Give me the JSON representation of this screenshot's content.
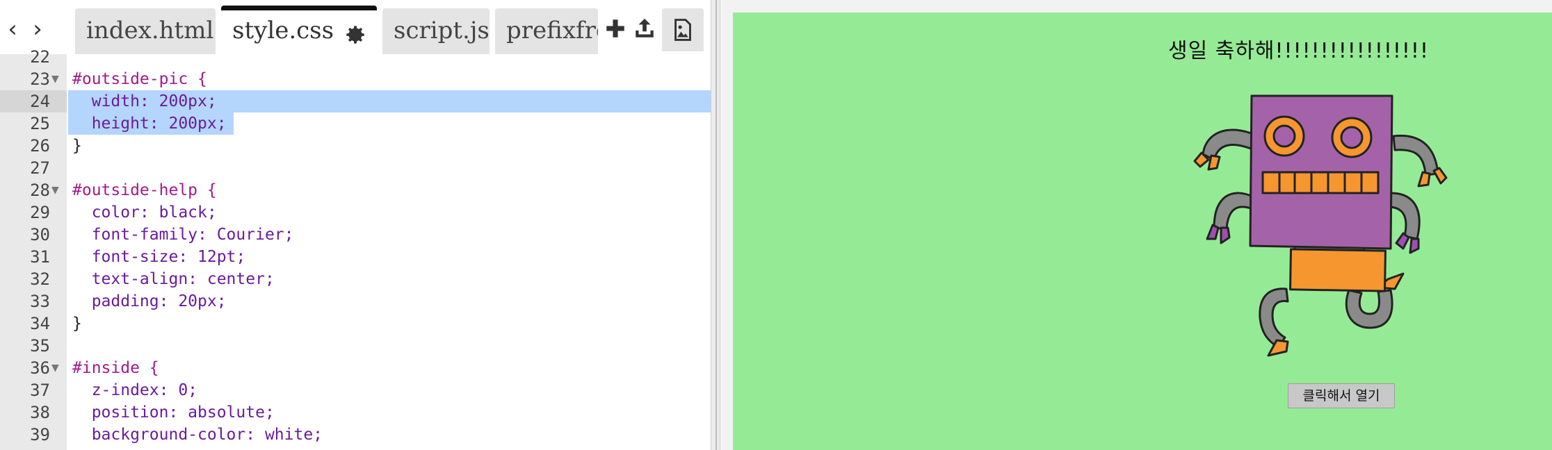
{
  "editor": {
    "nav": {
      "back_glyph": "‹",
      "forward_glyph": "›"
    },
    "tabs": [
      {
        "label": "index.html",
        "active": false
      },
      {
        "label": "style.css",
        "active": true
      },
      {
        "label": "script.js",
        "active": false
      },
      {
        "label": "prefixfree",
        "active": false
      }
    ],
    "toolbar": {
      "gear_icon": "gear-icon",
      "add_icon": "plus-icon",
      "upload_icon": "upload-icon",
      "image_icon": "image-icon"
    },
    "lines": [
      {
        "num": "22",
        "text": ""
      },
      {
        "num": "23",
        "text": "#outside-pic {"
      },
      {
        "num": "24",
        "text": "  width: 200px;"
      },
      {
        "num": "25",
        "text": "  height: 200px;"
      },
      {
        "num": "26",
        "text": "}"
      },
      {
        "num": "27",
        "text": ""
      },
      {
        "num": "28",
        "text": "#outside-help {"
      },
      {
        "num": "29",
        "text": "  color: black;"
      },
      {
        "num": "30",
        "text": "  font-family: Courier;"
      },
      {
        "num": "31",
        "text": "  font-size: 12pt;"
      },
      {
        "num": "32",
        "text": "  text-align: center;"
      },
      {
        "num": "33",
        "text": "  padding: 20px;"
      },
      {
        "num": "34",
        "text": "}"
      },
      {
        "num": "35",
        "text": ""
      },
      {
        "num": "36",
        "text": "#inside {"
      },
      {
        "num": "37",
        "text": "  z-index: 0;"
      },
      {
        "num": "38",
        "text": "  position: absolute;"
      },
      {
        "num": "39",
        "text": "  background-color: white;"
      }
    ]
  },
  "preview": {
    "birthday_text": "생일 축하해!!!!!!!!!!!!!!!!!",
    "open_button_label": "클릭해서 열기",
    "background_color": "#95eb95",
    "robot_colors": {
      "body": "#a463a8",
      "accent": "#f5962f",
      "limb": "#8a8a8a",
      "claw": "#a04fb0"
    }
  },
  "colors": {
    "selection": "#b4d5fe",
    "selector": "#a21a8a",
    "property": "#6a1b9a",
    "number": "#1a1aa6",
    "unit": "#b000b0",
    "active_tab_border": "#111111",
    "tab_bg": "#e4e4e4"
  }
}
